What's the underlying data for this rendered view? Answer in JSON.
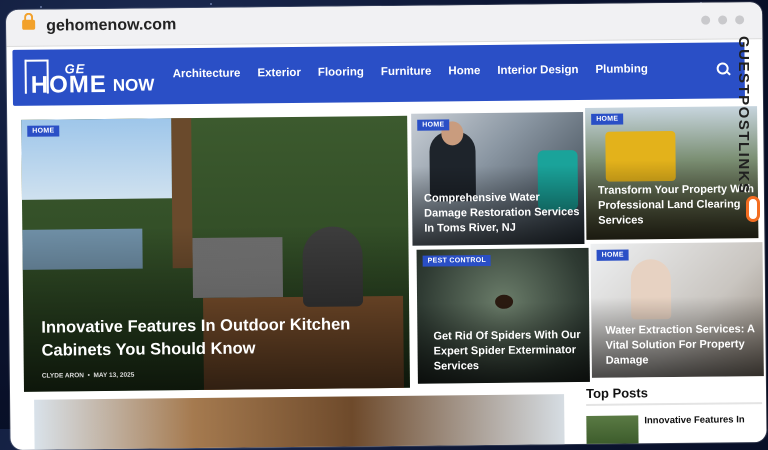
{
  "browser": {
    "url": "gehomenow.com"
  },
  "site": {
    "logo_top": "GE",
    "logo_home": "HOME",
    "logo_now": "NOW",
    "nav": [
      "Architecture",
      "Exterior",
      "Flooring",
      "Furniture",
      "Home",
      "Interior Design",
      "Plumbing"
    ],
    "accent_color": "#2a4fc6"
  },
  "articles": [
    {
      "category": "HOME",
      "title": "Innovative Features In Outdoor Kitchen Cabinets You Should Know",
      "author": "CLYDE ARON",
      "date": "MAY 13, 2025"
    },
    {
      "category": "HOME",
      "title": "Comprehensive Water Damage Restoration Services In Toms River, NJ"
    },
    {
      "category": "HOME",
      "title": "Transform Your Property With Professional Land Clearing Services"
    },
    {
      "category": "PEST CONTROL",
      "title": "Get Rid Of Spiders With Our Expert Spider Exterminator Services"
    },
    {
      "category": "HOME",
      "title": "Water Extraction Services: A Vital Solution For Property Damage"
    }
  ],
  "top_posts": {
    "heading": "Top Posts",
    "items": [
      "Innovative Features In"
    ]
  },
  "watermark": {
    "text": "GUESTPOSTLINKS",
    "brand_color": "#f36d21"
  }
}
